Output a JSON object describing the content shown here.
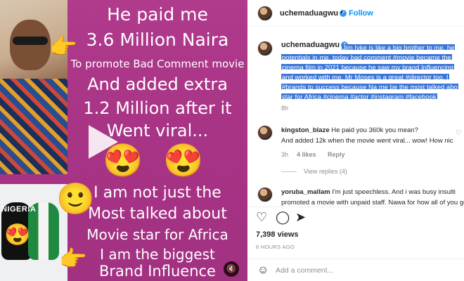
{
  "media": {
    "caption_lines": [
      {
        "text": "He paid me",
        "size": "large"
      },
      {
        "text": "3.6 Million Naira",
        "size": "large"
      },
      {
        "text": "To promote Bad Comment movie",
        "size": "small"
      },
      {
        "text": "And added extra",
        "size": "large"
      },
      {
        "text": "1.2 Million after it",
        "size": "large"
      },
      {
        "text": "Went viral...",
        "size": "large"
      },
      {
        "text": "I am not just the",
        "size": "large"
      },
      {
        "text": "Most talked about",
        "size": "large"
      },
      {
        "text": "Movie star for Africa",
        "size": "large"
      },
      {
        "text": "I am the biggest",
        "size": "large"
      },
      {
        "text": "Brand Influence",
        "size": "large"
      }
    ],
    "gloves_label": "NIGERIA",
    "emojis": {
      "heart_eyes": "😍",
      "smile": "🙂",
      "pointing": "👉"
    },
    "mute_icon": "speaker-muted-icon"
  },
  "header": {
    "username": "uchemaduagwu",
    "verified": true,
    "separator": "•",
    "follow_label": "Follow"
  },
  "caption": {
    "username": "uchemaduagwu",
    "lines": [
      "Jim Iyke is like a big brother to me, he",
      "potentials in me, today bad comment #movie became the",
      "cinema film in 2021 because he saw my brand Influencing",
      "and worked with me, Mr Moses is a great #director too. I",
      "#brands to success because Na me be the most talked abo",
      "star for Africa #cinema #actor #instagram #facebook"
    ],
    "time": "8h"
  },
  "comments": [
    {
      "username": "kingston_blaze",
      "line1": "He paid you 360k you mean?",
      "line2": "And added 12k when the movie went viral... wow! How nic",
      "time": "3h",
      "likes": "4 likes",
      "reply": "Reply",
      "view_replies": "View replies (4)"
    },
    {
      "username": "yoruba_mallam",
      "line1": "I'm just speechless. And i was busy insulti",
      "line2": "promoted a movie with unpaid staff. Nawa for how all of you go"
    }
  ],
  "actions": {
    "like_icon": "heart-icon",
    "comment_icon": "comment-icon",
    "share_icon": "share-icon",
    "save_icon": "bookmark-icon"
  },
  "stats": {
    "views": "7,398 views",
    "posted": "8 HOURS AGO"
  },
  "add_comment": {
    "placeholder": "Add a comment..."
  },
  "colors": {
    "media_bg": "#a93686",
    "selection": "#3a76d8",
    "follow": "#0095f6"
  }
}
